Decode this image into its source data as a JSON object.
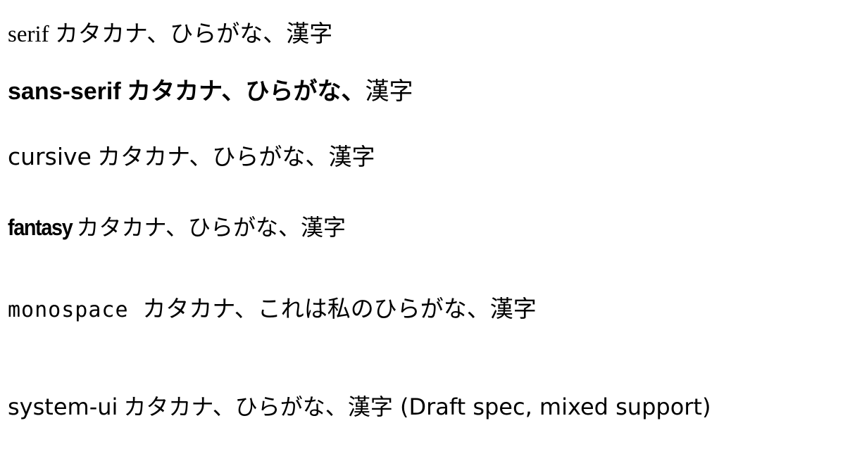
{
  "lines": [
    {
      "family": "serif",
      "sample": "カタカナ、ひらがな、",
      "kanji": "漢字",
      "note": ""
    },
    {
      "family": "sans-serif",
      "sample": "カタカナ、ひらがな、",
      "kanji": "漢字",
      "note": ""
    },
    {
      "family": "cursive",
      "sample": "カタカナ、ひらがな、",
      "kanji": "漢字",
      "note": ""
    },
    {
      "family": "fantasy",
      "sample": "カタカナ、ひらがな、",
      "kanji": "漢字",
      "note": ""
    },
    {
      "family": "monospace",
      "sample": "カタカナ、これは私のひらがな、",
      "kanji": "漢字",
      "note": ""
    },
    {
      "family": "system-ui",
      "sample": "カタカナ、ひらがな、",
      "kanji": "漢字",
      "note": " (Draft spec, mixed support)"
    }
  ]
}
